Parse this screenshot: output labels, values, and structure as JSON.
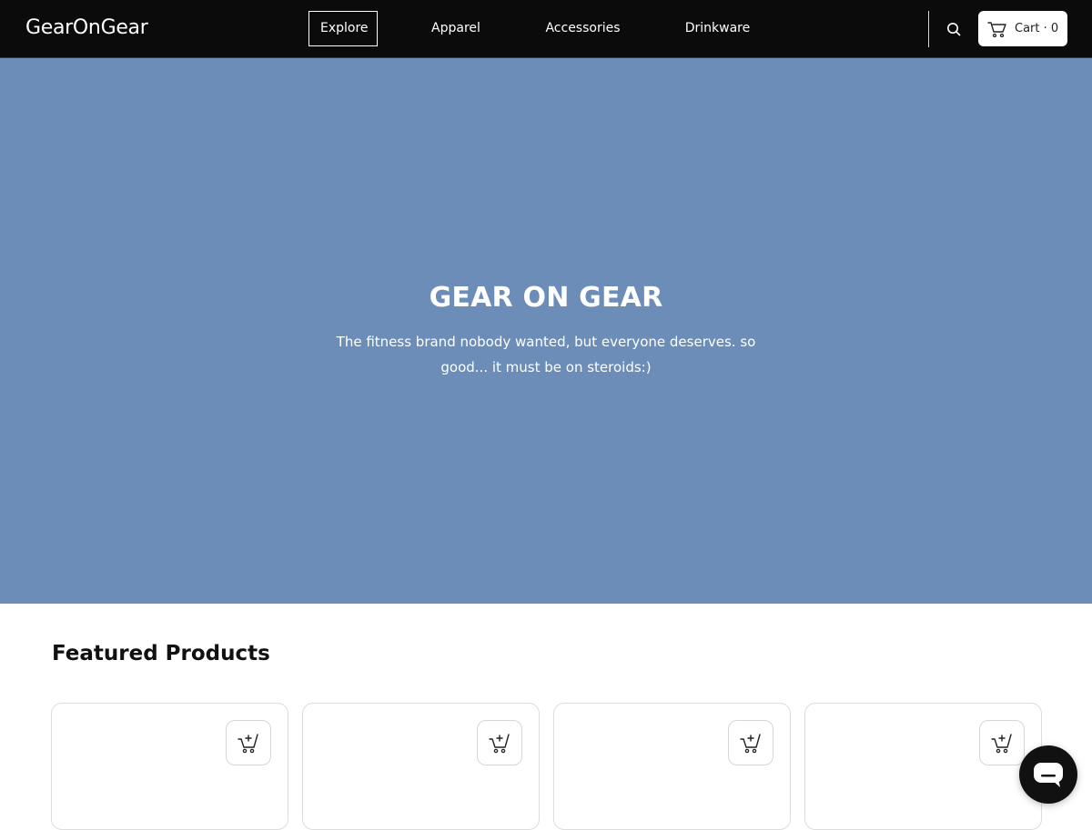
{
  "header": {
    "logo": "GearOnGear",
    "nav": [
      {
        "label": "Explore",
        "active": true
      },
      {
        "label": "Apparel",
        "active": false
      },
      {
        "label": "Accessories",
        "active": false
      },
      {
        "label": "Drinkware",
        "active": false
      }
    ],
    "cart_label": "Cart · 0",
    "search_icon": "search-icon",
    "cart_icon": "cart-icon"
  },
  "hero": {
    "title": "GEAR ON GEAR",
    "subtitle": "The fitness brand nobody wanted, but everyone deserves. so good... it must be on steroids:)",
    "background": "#6b8db8"
  },
  "featured": {
    "title": "Featured Products",
    "cards": [
      {
        "action_icon": "add-to-cart-icon"
      },
      {
        "action_icon": "add-to-cart-icon"
      },
      {
        "action_icon": "add-to-cart-icon"
      },
      {
        "action_icon": "add-to-cart-icon"
      }
    ]
  },
  "chat": {
    "icon": "chat-icon"
  },
  "colors": {
    "nav_bg": "#0b0b0b",
    "hero_bg": "#6b8db8",
    "accent": "#111111"
  }
}
